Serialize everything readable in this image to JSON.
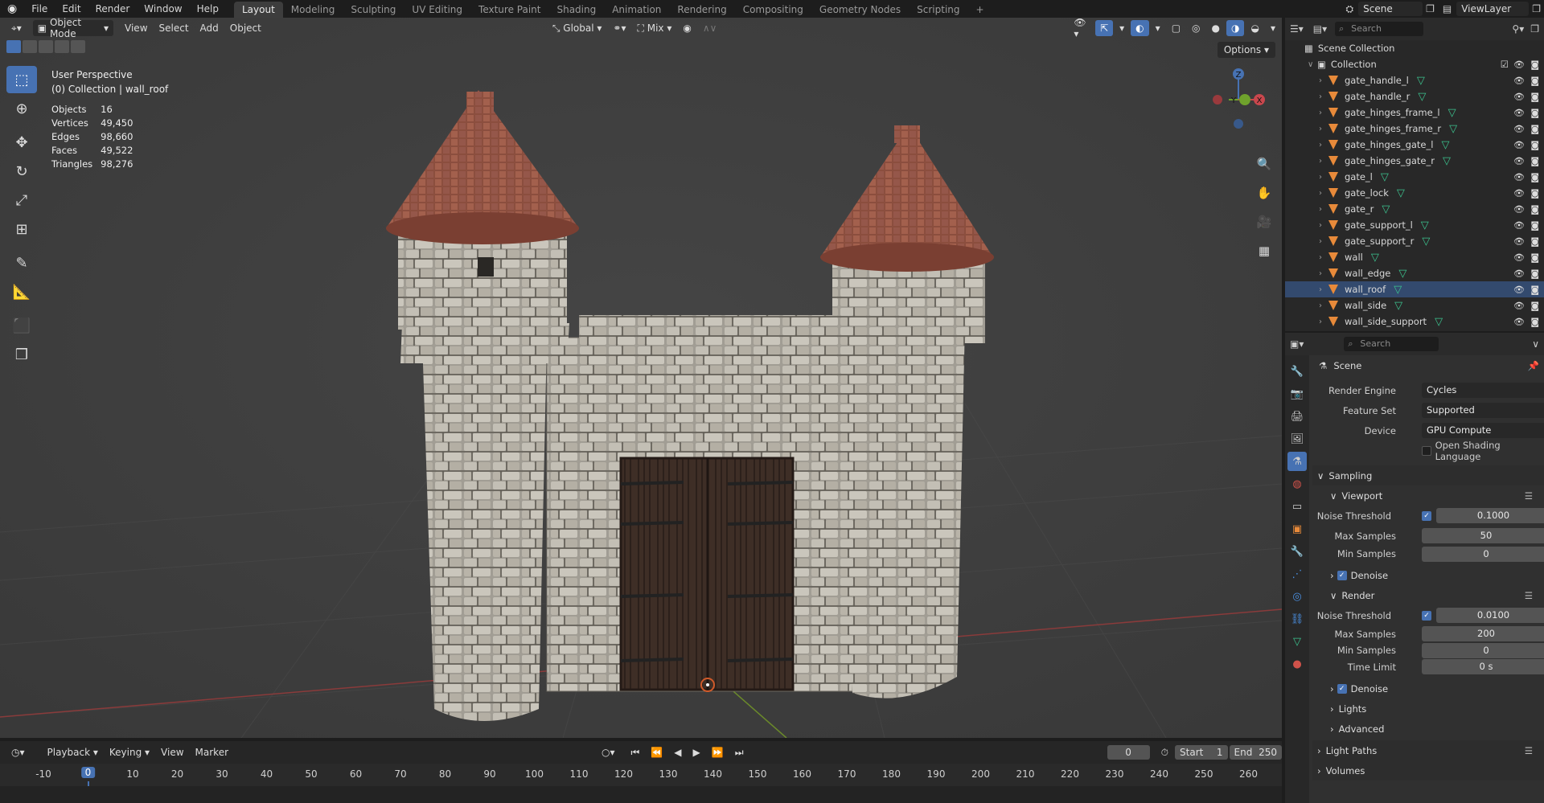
{
  "topbar": {
    "menus": [
      "File",
      "Edit",
      "Render",
      "Window",
      "Help"
    ],
    "workspaces": [
      "Layout",
      "Modeling",
      "Sculpting",
      "UV Editing",
      "Texture Paint",
      "Shading",
      "Animation",
      "Rendering",
      "Compositing",
      "Geometry Nodes",
      "Scripting"
    ],
    "active_workspace": "Layout",
    "add_tab": "+",
    "scene": "Scene",
    "view_layer": "ViewLayer"
  },
  "viewport": {
    "mode": "Object Mode",
    "menus": [
      "View",
      "Select",
      "Add",
      "Object"
    ],
    "transform_orientation": "Global",
    "snap_mode": "Mix",
    "options": "Options",
    "perspective": "User Perspective",
    "collection_path": "(0) Collection | wall_roof",
    "stats": [
      {
        "label": "Objects",
        "value": "16"
      },
      {
        "label": "Vertices",
        "value": "49,450"
      },
      {
        "label": "Edges",
        "value": "98,660"
      },
      {
        "label": "Faces",
        "value": "49,522"
      },
      {
        "label": "Triangles",
        "value": "98,276"
      }
    ],
    "gizmo": {
      "z": "Z",
      "y": "Y",
      "x": "X"
    }
  },
  "timeline": {
    "menus": [
      "Playback",
      "Keying",
      "View",
      "Marker"
    ],
    "current_frame": "0",
    "start_label": "Start",
    "start": "1",
    "end_label": "End",
    "end": "250",
    "ruler": [
      "-10",
      "0",
      "10",
      "20",
      "30",
      "40",
      "50",
      "60",
      "70",
      "80",
      "90",
      "100",
      "110",
      "120",
      "130",
      "140",
      "150",
      "160",
      "170",
      "180",
      "190",
      "200",
      "210",
      "220",
      "230",
      "240",
      "250",
      "260"
    ]
  },
  "outliner": {
    "search_placeholder": "Search",
    "scene_collection": "Scene Collection",
    "collection": "Collection",
    "objects": [
      "gate_handle_l",
      "gate_handle_r",
      "gate_hinges_frame_l",
      "gate_hinges_frame_r",
      "gate_hinges_gate_l",
      "gate_hinges_gate_r",
      "gate_l",
      "gate_lock",
      "gate_r",
      "gate_support_l",
      "gate_support_r",
      "wall",
      "wall_edge",
      "wall_roof",
      "wall_side",
      "wall_side_support"
    ]
  },
  "properties": {
    "search_placeholder": "Search",
    "context": "Scene",
    "render_engine_label": "Render Engine",
    "render_engine": "Cycles",
    "feature_set_label": "Feature Set",
    "feature_set": "Supported",
    "device_label": "Device",
    "device": "GPU Compute",
    "osl": "Open Shading Language",
    "sampling": "Sampling",
    "viewport_section": "Viewport",
    "noise_threshold_label": "Noise Threshold",
    "vp_noise": "0.1000",
    "max_samples_label": "Max Samples",
    "vp_max": "50",
    "min_samples_label": "Min Samples",
    "vp_min": "0",
    "denoise": "Denoise",
    "render_section": "Render",
    "r_noise": "0.0100",
    "r_max": "200",
    "r_min": "0",
    "time_limit_label": "Time Limit",
    "time_limit": "0 s",
    "lights": "Lights",
    "advanced": "Advanced",
    "light_paths": "Light Paths",
    "volumes": "Volumes"
  },
  "colors": {
    "accent": "#4772b3",
    "object_icon": "#e88a3a",
    "mesh_icon": "#3cc48f"
  }
}
